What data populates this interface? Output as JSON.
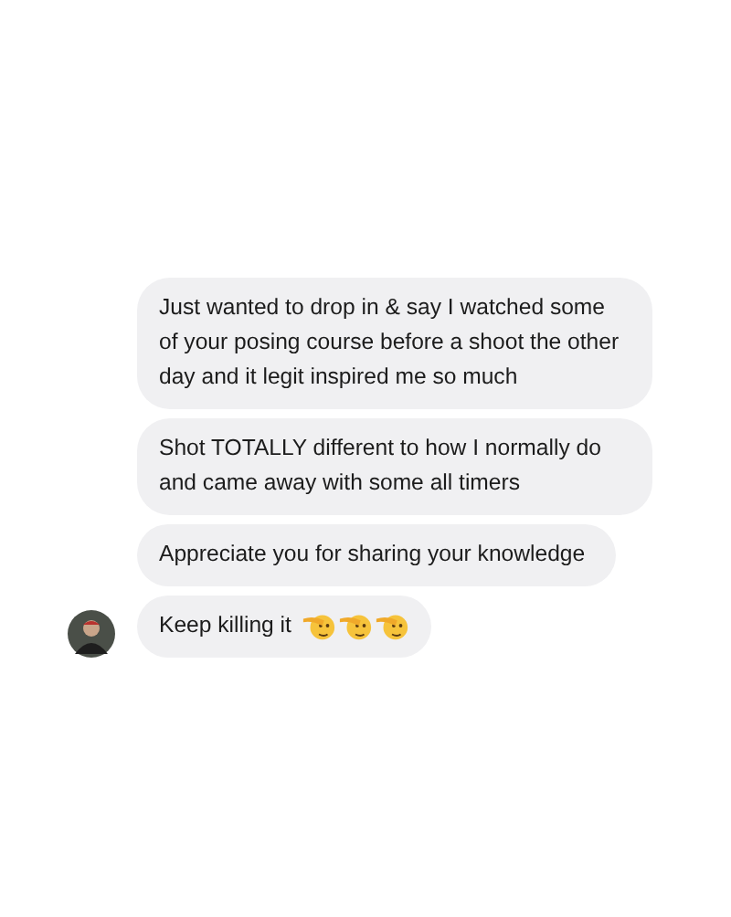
{
  "messages": [
    {
      "text": "Just wanted to drop in & say I watched some of your posing course before a shoot the other day and it legit inspired me so much"
    },
    {
      "text": "Shot TOTALLY different to how I normally do and came away with some all timers"
    },
    {
      "text": "Appreciate you for sharing your knowledge"
    },
    {
      "text": "Keep killing it",
      "emojis": [
        {
          "kind": "salute"
        },
        {
          "kind": "salute"
        },
        {
          "kind": "salute"
        }
      ]
    }
  ]
}
